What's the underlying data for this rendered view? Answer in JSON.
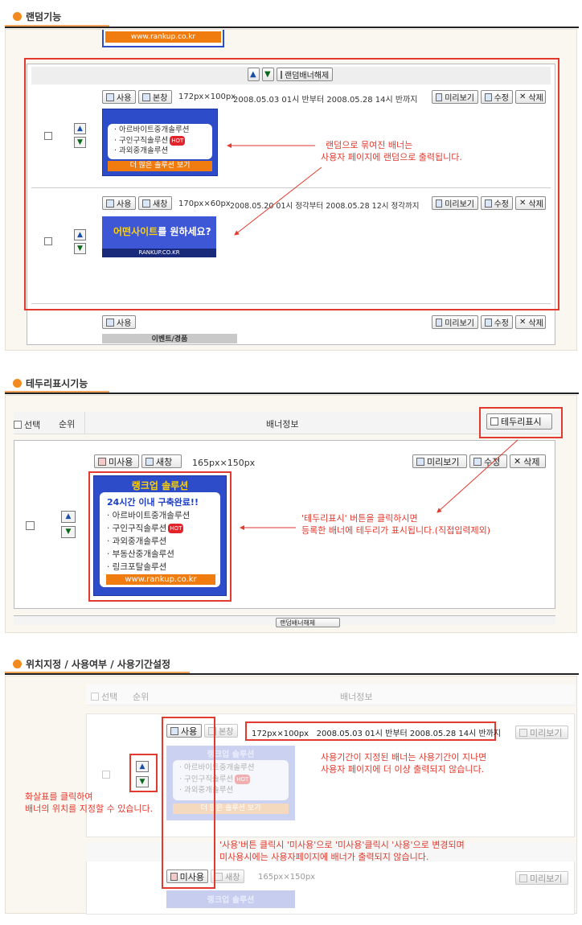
{
  "sections": [
    {
      "title": "랜덤기능"
    },
    {
      "title": "테두리표시기능"
    },
    {
      "title": "위치지정 / 사용여부 / 사용기간설정"
    }
  ],
  "s1": {
    "top_banner_url": "www.rankup.co.kr",
    "random_release_label": "랜덤배너해제",
    "row1": {
      "use_label": "사용",
      "new_label": "본창",
      "size": "172px×100px",
      "period": "2008.05.03 01시 반부터 2008.05.28 14시 반까지",
      "preview_label": "미리보기",
      "edit_label": "수정",
      "delete_label": "삭제",
      "banner_items": [
        "· 아르바이트중개솔루션",
        "· 구인구직솔루션",
        "· 과외중개솔루션"
      ],
      "hot": "HOT",
      "banner_more": "더 많은 솔루션 보기"
    },
    "row2": {
      "use_label": "사용",
      "new_label": "새창",
      "size": "170px×60px",
      "period": "2008.05.20 01시 정각부터 2008.05.28 12시 정각까지",
      "preview_label": "미리보기",
      "edit_label": "수정",
      "delete_label": "삭제",
      "banner_text_a": "어떤사이트",
      "banner_text_b": "를 원하세요?",
      "banner_url": "RANKUP.CO.KR"
    },
    "row3": {
      "use_label": "사용",
      "preview_label": "미리보기",
      "edit_label": "수정",
      "delete_label": "삭제",
      "event_label": "이벤트/경품"
    },
    "annotation": [
      "랜덤으로 묶여진 배너는",
      "사용자 페이지에 랜덤으로 출력됩니다."
    ]
  },
  "s2": {
    "col_select": "선택",
    "col_rank": "순위",
    "col_info": "배너정보",
    "border_btn": "테두리표시",
    "unuse_label": "미사용",
    "new_label": "새창",
    "size": "165px×150px",
    "preview_label": "미리보기",
    "edit_label": "수정",
    "delete_label": "삭제",
    "banner_title": "랭크업 솔루션",
    "banner_sub": "24시간 이내 구축완료!!",
    "banner_items": [
      "· 아르바이트중개솔루션",
      "· 구인구직솔루션",
      "· 과외중개솔루션",
      "· 부동산중개솔루션",
      "· 링크포탈솔루션"
    ],
    "hot": "HOT",
    "banner_url": "www.rankup.co.kr",
    "annotation": [
      "'테두리표시' 버튼을 클릭하시면",
      "등록한 배너에 테두리가 표시됩니다.(직접입력제외)"
    ],
    "bottom_label": "랜덤배너해제"
  },
  "s3": {
    "col_select": "선택",
    "col_rank": "순위",
    "col_info": "배너정보",
    "use_label": "사용",
    "new_label": "본창",
    "period_box": "172px×100px   2008.05.03 01시 반부터 2008.05.28 14시 반까지",
    "preview_label": "미리보기",
    "banner_title": "랭크업 솔루션",
    "banner_items": [
      "· 아르바이트중개솔루션",
      "· 구인구직솔루션",
      "· 과외중개솔루션"
    ],
    "hot": "HOT",
    "banner_more": "더 많은 솔루션 보기",
    "unuse_label": "미사용",
    "new_label2": "새창",
    "size2": "165px×150px",
    "preview_label2": "미리보기",
    "banner_title2": "랭크업 솔루션",
    "annot_arrow": [
      "화살표를 클릭하여",
      "배너의 위치를 지정할 수 있습니다."
    ],
    "annot_period": [
      "사용기간이 지정된 배너는 사용기간이 지나면",
      "사용자 페이지에 더 이상 출력되지 않습니다."
    ],
    "annot_use": [
      "'사용'버튼 클릭시 '미사용'으로 '미사용'클릭시 '사용'으로 변경되며",
      "미사용시에는 사용자페이지에 배너가 출력되지 않습니다."
    ]
  },
  "colors": {
    "accent": "#f07c10",
    "red": "#e23a2e",
    "banner_blue": "#2d4cc9"
  }
}
